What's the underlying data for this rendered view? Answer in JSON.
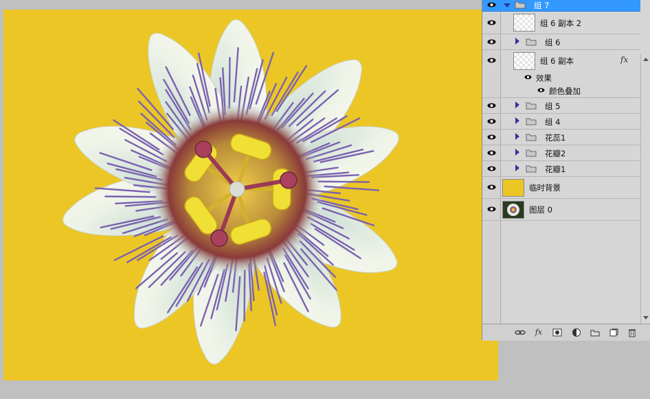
{
  "canvas": {
    "background_color": "#ecc625",
    "image_subject": "passion-flower"
  },
  "layers": [
    {
      "name": "组 7",
      "kind": "group",
      "expanded": true,
      "selected": true
    },
    {
      "name": "组 6 副本 2",
      "kind": "layer"
    },
    {
      "name": "组 6",
      "kind": "group",
      "expanded": false
    },
    {
      "name": "组 6 副本",
      "kind": "layer",
      "fx": "fx"
    },
    {
      "name": "效果",
      "kind": "effect-header"
    },
    {
      "name": "颜色叠加",
      "kind": "effect"
    },
    {
      "name": "组 5",
      "kind": "group",
      "expanded": false
    },
    {
      "name": "组 4",
      "kind": "group",
      "expanded": false
    },
    {
      "name": "花蕊1",
      "kind": "group",
      "expanded": false
    },
    {
      "name": "花瓣2",
      "kind": "group",
      "expanded": false
    },
    {
      "name": "花瓣1",
      "kind": "group",
      "expanded": false
    },
    {
      "name": "临时背景",
      "kind": "layer",
      "thumb_color": "#ecc625"
    },
    {
      "name": "图层 0",
      "kind": "layer",
      "thumb": "flower"
    }
  ],
  "footer_icons": [
    "link-icon",
    "fx-icon",
    "mask-icon",
    "adjustment-icon",
    "new-group-icon",
    "new-layer-icon",
    "trash-icon"
  ],
  "footer_labels": {
    "fx": "fx"
  },
  "colors": {
    "selection": "#3399ff",
    "panel": "#d6d6d6",
    "workspace": "#c0c0c0"
  }
}
